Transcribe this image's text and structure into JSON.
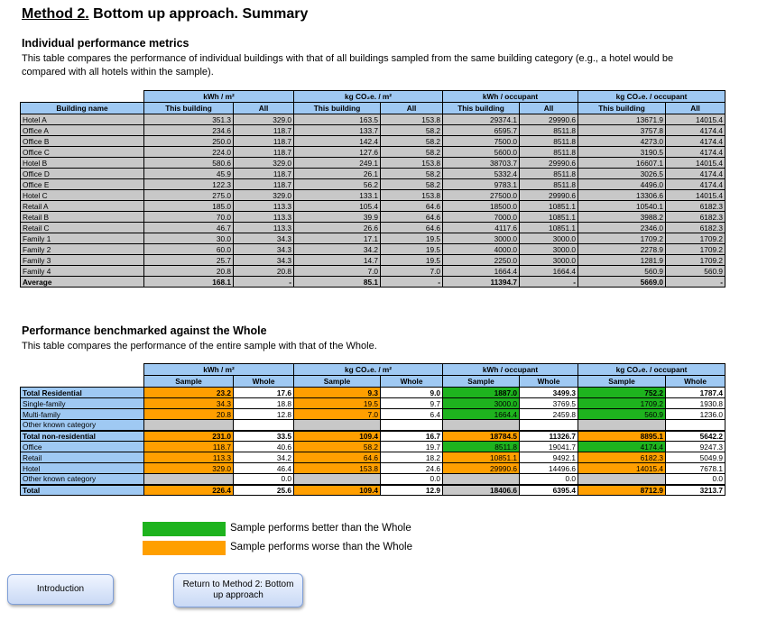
{
  "page": {
    "title_underlined": "Method 2.",
    "title_rest": " Bottom up approach. Summary"
  },
  "section1": {
    "title": "Individual performance metrics",
    "description": "This table compares the performance of individual buildings with that of all buildings sampled from the same building category (e.g., a hotel would be compared with all hotels within the sample).",
    "group_headers": [
      "kWh / m²",
      "kg CO₂e. / m²",
      "kWh / occupant",
      "kg CO₂e. / occupant"
    ],
    "name_header": "Building name",
    "sub_headers": [
      "This building",
      "All",
      "This building",
      "All",
      "This building",
      "All",
      "This building",
      "All"
    ],
    "rows": [
      [
        "Hotel A",
        "351.3",
        "329.0",
        "163.5",
        "153.8",
        "29374.1",
        "29990.6",
        "13671.9",
        "14015.4"
      ],
      [
        "Office A",
        "234.6",
        "118.7",
        "133.7",
        "58.2",
        "6595.7",
        "8511.8",
        "3757.8",
        "4174.4"
      ],
      [
        "Office B",
        "250.0",
        "118.7",
        "142.4",
        "58.2",
        "7500.0",
        "8511.8",
        "4273.0",
        "4174.4"
      ],
      [
        "Office C",
        "224.0",
        "118.7",
        "127.6",
        "58.2",
        "5600.0",
        "8511.8",
        "3190.5",
        "4174.4"
      ],
      [
        "Hotel B",
        "580.6",
        "329.0",
        "249.1",
        "153.8",
        "38703.7",
        "29990.6",
        "16607.1",
        "14015.4"
      ],
      [
        "Office D",
        "45.9",
        "118.7",
        "26.1",
        "58.2",
        "5332.4",
        "8511.8",
        "3026.5",
        "4174.4"
      ],
      [
        "Office E",
        "122.3",
        "118.7",
        "56.2",
        "58.2",
        "9783.1",
        "8511.8",
        "4496.0",
        "4174.4"
      ],
      [
        "Hotel C",
        "275.0",
        "329.0",
        "133.1",
        "153.8",
        "27500.0",
        "29990.6",
        "13306.6",
        "14015.4"
      ],
      [
        "Retail A",
        "185.0",
        "113.3",
        "105.4",
        "64.6",
        "18500.0",
        "10851.1",
        "10540.1",
        "6182.3"
      ],
      [
        "Retail B",
        "70.0",
        "113.3",
        "39.9",
        "64.6",
        "7000.0",
        "10851.1",
        "3988.2",
        "6182.3"
      ],
      [
        "Retail C",
        "46.7",
        "113.3",
        "26.6",
        "64.6",
        "4117.6",
        "10851.1",
        "2346.0",
        "6182.3"
      ],
      [
        "Family 1",
        "30.0",
        "34.3",
        "17.1",
        "19.5",
        "3000.0",
        "3000.0",
        "1709.2",
        "1709.2"
      ],
      [
        "Family 2",
        "60.0",
        "34.3",
        "34.2",
        "19.5",
        "4000.0",
        "3000.0",
        "2278.9",
        "1709.2"
      ],
      [
        "Family 3",
        "25.7",
        "34.3",
        "14.7",
        "19.5",
        "2250.0",
        "3000.0",
        "1281.9",
        "1709.2"
      ],
      [
        "Family 4",
        "20.8",
        "20.8",
        "7.0",
        "7.0",
        "1664.4",
        "1664.4",
        "560.9",
        "560.9"
      ]
    ],
    "average_row": [
      "Average",
      "168.1",
      "-",
      "85.1",
      "-",
      "11394.7",
      "-",
      "5669.0",
      "-"
    ]
  },
  "section2": {
    "title": "Performance benchmarked against the Whole",
    "description": "This table compares the performance of the entire sample with that of the Whole.",
    "group_headers": [
      "kWh / m²",
      "kg CO₂e. / m²",
      "kWh / occupant",
      "kg CO₂e. / occupant"
    ],
    "sub_headers": [
      "Sample",
      "Whole",
      "Sample",
      "Whole",
      "Sample",
      "Whole",
      "Sample",
      "Whole"
    ],
    "rows": [
      {
        "name": "Total Residential",
        "bold": true,
        "thick": false,
        "vals": [
          "23.2",
          "17.6",
          "9.3",
          "9.0",
          "1887.0",
          "3499.3",
          "752.2",
          "1787.4"
        ],
        "colors": [
          "orange",
          "",
          "orange",
          "",
          "green",
          "",
          "green",
          ""
        ]
      },
      {
        "name": "Single-family",
        "bold": false,
        "thick": false,
        "vals": [
          "34.3",
          "18.8",
          "19.5",
          "9.7",
          "3000.0",
          "3769.5",
          "1709.2",
          "1930.8"
        ],
        "colors": [
          "orange",
          "",
          "orange",
          "",
          "green",
          "",
          "green",
          ""
        ]
      },
      {
        "name": "Multi-family",
        "bold": false,
        "thick": false,
        "vals": [
          "20.8",
          "12.8",
          "7.0",
          "6.4",
          "1664.4",
          "2459.8",
          "560.9",
          "1236.0"
        ],
        "colors": [
          "orange",
          "",
          "orange",
          "",
          "green",
          "",
          "green",
          ""
        ]
      },
      {
        "name": "Other known category",
        "bold": false,
        "thick": false,
        "vals": [
          "",
          "",
          "",
          "",
          "",
          "",
          "",
          ""
        ],
        "colors": [
          "gray",
          "",
          "gray",
          "",
          "gray",
          "",
          "gray",
          ""
        ]
      },
      {
        "name": "Total non-residential",
        "bold": true,
        "thick": true,
        "vals": [
          "231.0",
          "33.5",
          "109.4",
          "16.7",
          "18784.5",
          "11326.7",
          "8895.1",
          "5642.2"
        ],
        "colors": [
          "orange",
          "",
          "orange",
          "",
          "orange",
          "",
          "orange",
          ""
        ]
      },
      {
        "name": "Office",
        "bold": false,
        "thick": false,
        "vals": [
          "118.7",
          "40.6",
          "58.2",
          "19.7",
          "8511.8",
          "19041.7",
          "4174.4",
          "9247.3"
        ],
        "colors": [
          "orange",
          "",
          "orange",
          "",
          "green",
          "",
          "green",
          ""
        ]
      },
      {
        "name": "Retail",
        "bold": false,
        "thick": false,
        "vals": [
          "113.3",
          "34.2",
          "64.6",
          "18.2",
          "10851.1",
          "9492.1",
          "6182.3",
          "5049.9"
        ],
        "colors": [
          "orange",
          "",
          "orange",
          "",
          "orange",
          "",
          "orange",
          ""
        ]
      },
      {
        "name": "Hotel",
        "bold": false,
        "thick": false,
        "vals": [
          "329.0",
          "46.4",
          "153.8",
          "24.6",
          "29990.6",
          "14496.6",
          "14015.4",
          "7678.1"
        ],
        "colors": [
          "orange",
          "",
          "orange",
          "",
          "orange",
          "",
          "orange",
          ""
        ]
      },
      {
        "name": "Other known category",
        "bold": false,
        "thick": false,
        "vals": [
          "",
          "0.0",
          "",
          "0.0",
          "",
          "0.0",
          "",
          "0.0"
        ],
        "colors": [
          "gray",
          "",
          "gray",
          "",
          "gray",
          "",
          "gray",
          ""
        ]
      },
      {
        "name": "Total",
        "bold": true,
        "thick": true,
        "vals": [
          "226.4",
          "25.6",
          "109.4",
          "12.9",
          "18406.6",
          "6395.4",
          "8712.9",
          "3213.7"
        ],
        "colors": [
          "orange",
          "",
          "orange",
          "",
          "gray",
          "",
          "orange",
          ""
        ]
      }
    ]
  },
  "legend": {
    "better_color": "#1eb31e",
    "worse_color": "#ff9f00",
    "better_label": "Sample performs better than the Whole",
    "worse_label": "Sample performs worse than the Whole"
  },
  "nav": {
    "intro_label": "Introduction",
    "return_label": "Return to Method 2: Bottom up approach"
  }
}
